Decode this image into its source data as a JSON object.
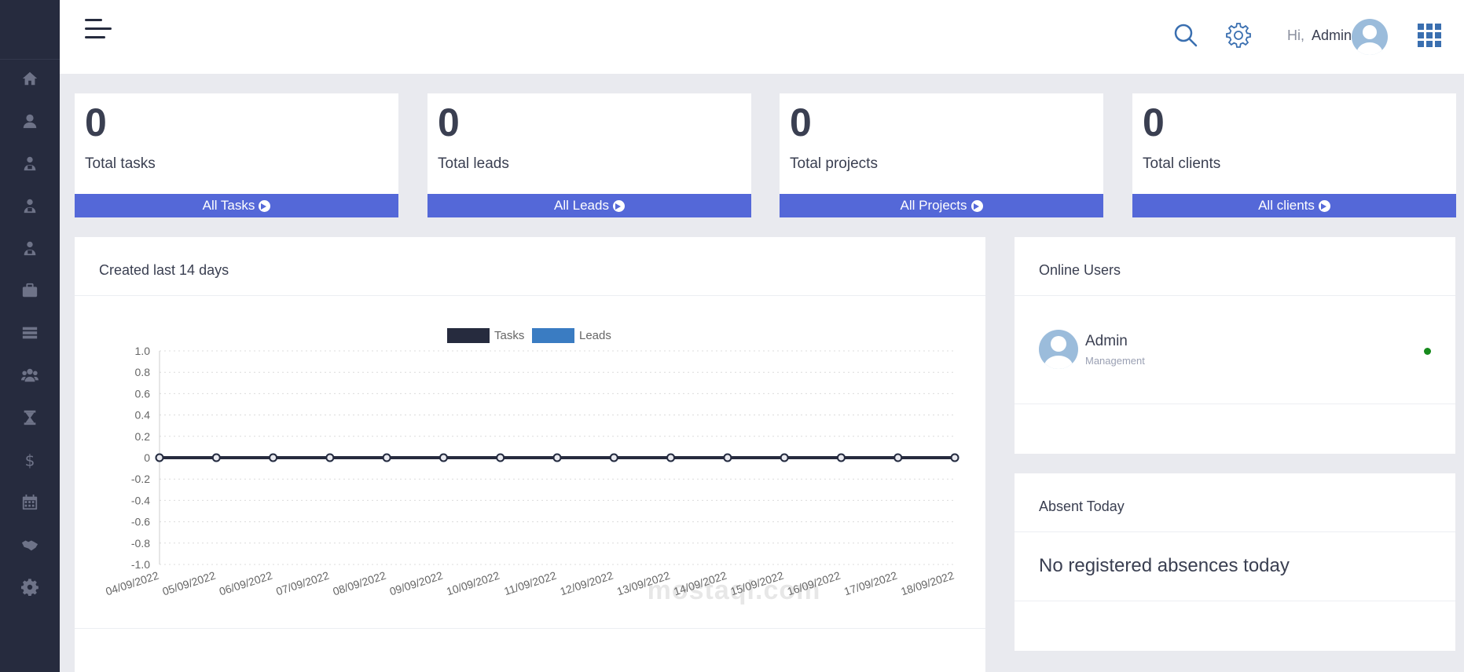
{
  "sidebar": {
    "items": [
      {
        "icon": "home-icon"
      },
      {
        "icon": "user-icon"
      },
      {
        "icon": "employee-badge-icon"
      },
      {
        "icon": "employee-badge-icon"
      },
      {
        "icon": "employee-badge-icon"
      },
      {
        "icon": "briefcase-icon"
      },
      {
        "icon": "list-icon"
      },
      {
        "icon": "users-icon"
      },
      {
        "icon": "hourglass-icon"
      },
      {
        "icon": "dollar-icon"
      },
      {
        "icon": "calendar-icon"
      },
      {
        "icon": "handshake-icon"
      },
      {
        "icon": "gear-icon"
      }
    ]
  },
  "header": {
    "greeting_prefix": "Hi,",
    "user_name": "Admin"
  },
  "stats": [
    {
      "value": "0",
      "label": "Total tasks",
      "link": "All Tasks"
    },
    {
      "value": "0",
      "label": "Total leads",
      "link": "All Leads"
    },
    {
      "value": "0",
      "label": "Total projects",
      "link": "All Projects"
    },
    {
      "value": "0",
      "label": "Total clients",
      "link": "All clients"
    }
  ],
  "chart_panel": {
    "title": "Created last 14 days"
  },
  "chart_data": {
    "type": "line",
    "x": [
      "04/09/2022",
      "05/09/2022",
      "06/09/2022",
      "07/09/2022",
      "08/09/2022",
      "09/09/2022",
      "10/09/2022",
      "11/09/2022",
      "12/09/2022",
      "13/09/2022",
      "14/09/2022",
      "15/09/2022",
      "16/09/2022",
      "17/09/2022",
      "18/09/2022"
    ],
    "series": [
      {
        "name": "Tasks",
        "color": "#262b3e",
        "values": [
          0,
          0,
          0,
          0,
          0,
          0,
          0,
          0,
          0,
          0,
          0,
          0,
          0,
          0,
          0
        ]
      },
      {
        "name": "Leads",
        "color": "#3a7cc2",
        "values": [
          0,
          0,
          0,
          0,
          0,
          0,
          0,
          0,
          0,
          0,
          0,
          0,
          0,
          0,
          0
        ]
      }
    ],
    "ylim": [
      -1.0,
      1.0
    ],
    "yticks": [
      "1.0",
      "0.8",
      "0.6",
      "0.4",
      "0.2",
      "0",
      "-0.2",
      "-0.4",
      "-0.6",
      "-0.8",
      "-1.0"
    ],
    "grid": true,
    "legend": "top"
  },
  "online_users": {
    "title": "Online Users",
    "users": [
      {
        "name": "Admin",
        "role": "Management",
        "status_color": "#168a1c"
      }
    ]
  },
  "absent_today": {
    "title": "Absent Today",
    "message": "No registered absences today"
  },
  "watermark": "mostaql.com",
  "colors": {
    "sidebar": "#262b3e",
    "accent": "#5468d8",
    "background": "#e9eaef"
  }
}
